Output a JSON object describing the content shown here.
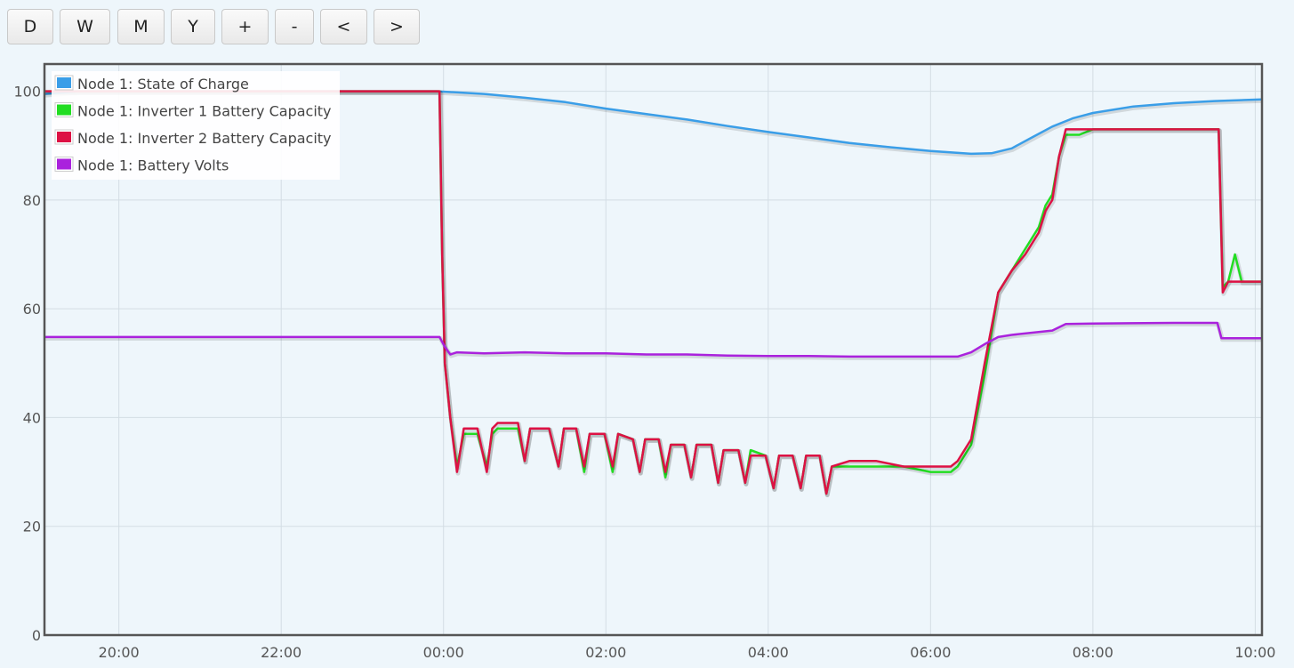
{
  "toolbar": {
    "buttons": [
      {
        "name": "day-button",
        "label": "D"
      },
      {
        "name": "week-button",
        "label": "W"
      },
      {
        "name": "month-button",
        "label": "M"
      },
      {
        "name": "year-button",
        "label": "Y"
      },
      {
        "name": "zoom-in-button",
        "label": "+"
      },
      {
        "name": "zoom-out-button",
        "label": "-"
      },
      {
        "name": "prev-button",
        "label": "<"
      },
      {
        "name": "next-button",
        "label": ">"
      }
    ]
  },
  "chart_data": {
    "type": "line",
    "x_unit": "time",
    "xlim": [
      "19:05",
      "10:05"
    ],
    "ylim": [
      0,
      105
    ],
    "x_ticks": [
      "20:00",
      "22:00",
      "00:00",
      "02:00",
      "04:00",
      "06:00",
      "08:00",
      "10:00"
    ],
    "y_ticks": [
      0,
      20,
      40,
      60,
      80,
      100
    ],
    "grid": true,
    "legend_position": "top-left",
    "colors": {
      "background": "#eef6fb",
      "frame": "#555555",
      "grid": "#d3dde4"
    },
    "series": [
      {
        "name": "Node 1: State of Charge",
        "color": "#3a9ee8",
        "points": [
          [
            "19:05",
            99.5
          ],
          [
            "19:30",
            100
          ],
          [
            "23:55",
            100
          ],
          [
            "00:30",
            99.5
          ],
          [
            "01:00",
            98.8
          ],
          [
            "01:30",
            98
          ],
          [
            "02:00",
            96.8
          ],
          [
            "02:30",
            95.8
          ],
          [
            "03:00",
            94.8
          ],
          [
            "03:30",
            93.6
          ],
          [
            "04:00",
            92.5
          ],
          [
            "04:30",
            91.5
          ],
          [
            "05:00",
            90.5
          ],
          [
            "05:30",
            89.7
          ],
          [
            "06:00",
            89
          ],
          [
            "06:30",
            88.5
          ],
          [
            "06:45",
            88.6
          ],
          [
            "07:00",
            89.5
          ],
          [
            "07:15",
            91.5
          ],
          [
            "07:30",
            93.5
          ],
          [
            "07:45",
            95
          ],
          [
            "08:00",
            96
          ],
          [
            "08:30",
            97.2
          ],
          [
            "09:00",
            97.8
          ],
          [
            "09:30",
            98.2
          ],
          [
            "10:05",
            98.5
          ]
        ]
      },
      {
        "name": "Node 1: Inverter 1 Battery Capacity",
        "color": "#22dd22",
        "points": [
          [
            "19:05",
            100
          ],
          [
            "23:57",
            100
          ],
          [
            "23:59",
            70
          ],
          [
            "00:01",
            50
          ],
          [
            "00:05",
            40
          ],
          [
            "00:10",
            31
          ],
          [
            "00:15",
            37
          ],
          [
            "00:25",
            37
          ],
          [
            "00:32",
            31
          ],
          [
            "00:36",
            37
          ],
          [
            "00:40",
            38
          ],
          [
            "00:55",
            38
          ],
          [
            "01:00",
            32
          ],
          [
            "01:04",
            38
          ],
          [
            "01:18",
            38
          ],
          [
            "01:25",
            31
          ],
          [
            "01:29",
            38
          ],
          [
            "01:38",
            38
          ],
          [
            "01:44",
            30
          ],
          [
            "01:48",
            37
          ],
          [
            "01:59",
            37
          ],
          [
            "02:05",
            30
          ],
          [
            "02:09",
            37
          ],
          [
            "02:20",
            36
          ],
          [
            "02:25",
            30
          ],
          [
            "02:29",
            36
          ],
          [
            "02:39",
            36
          ],
          [
            "02:44",
            29
          ],
          [
            "02:48",
            35
          ],
          [
            "02:58",
            35
          ],
          [
            "03:03",
            29
          ],
          [
            "03:07",
            35
          ],
          [
            "03:18",
            35
          ],
          [
            "03:23",
            28
          ],
          [
            "03:27",
            34
          ],
          [
            "03:38",
            34
          ],
          [
            "03:43",
            28
          ],
          [
            "03:47",
            34
          ],
          [
            "03:58",
            33
          ],
          [
            "04:04",
            27
          ],
          [
            "04:08",
            33
          ],
          [
            "04:18",
            33
          ],
          [
            "04:24",
            27
          ],
          [
            "04:28",
            33
          ],
          [
            "04:38",
            33
          ],
          [
            "04:43",
            26
          ],
          [
            "04:47",
            31
          ],
          [
            "05:00",
            31
          ],
          [
            "05:20",
            31
          ],
          [
            "05:40",
            31
          ],
          [
            "06:00",
            30
          ],
          [
            "06:15",
            30
          ],
          [
            "06:20",
            31
          ],
          [
            "06:30",
            35
          ],
          [
            "06:40",
            48
          ],
          [
            "06:50",
            63
          ],
          [
            "07:00",
            67
          ],
          [
            "07:10",
            71
          ],
          [
            "07:20",
            75
          ],
          [
            "07:25",
            79
          ],
          [
            "07:30",
            81
          ],
          [
            "07:35",
            88
          ],
          [
            "07:40",
            92
          ],
          [
            "07:50",
            92
          ],
          [
            "08:00",
            93
          ],
          [
            "08:30",
            93
          ],
          [
            "09:00",
            93
          ],
          [
            "09:30",
            93
          ],
          [
            "09:33",
            93
          ],
          [
            "09:36",
            64
          ],
          [
            "09:40",
            65
          ],
          [
            "09:45",
            70
          ],
          [
            "09:50",
            65
          ],
          [
            "10:05",
            65
          ]
        ]
      },
      {
        "name": "Node 1: Inverter 2 Battery Capacity",
        "color": "#dd1144",
        "points": [
          [
            "19:05",
            100
          ],
          [
            "23:57",
            100
          ],
          [
            "23:59",
            70
          ],
          [
            "00:01",
            50
          ],
          [
            "00:05",
            40
          ],
          [
            "00:10",
            30
          ],
          [
            "00:15",
            38
          ],
          [
            "00:25",
            38
          ],
          [
            "00:32",
            30
          ],
          [
            "00:36",
            38
          ],
          [
            "00:40",
            39
          ],
          [
            "00:55",
            39
          ],
          [
            "01:00",
            32
          ],
          [
            "01:04",
            38
          ],
          [
            "01:18",
            38
          ],
          [
            "01:25",
            31
          ],
          [
            "01:29",
            38
          ],
          [
            "01:38",
            38
          ],
          [
            "01:44",
            31
          ],
          [
            "01:48",
            37
          ],
          [
            "01:59",
            37
          ],
          [
            "02:05",
            31
          ],
          [
            "02:09",
            37
          ],
          [
            "02:20",
            36
          ],
          [
            "02:25",
            30
          ],
          [
            "02:29",
            36
          ],
          [
            "02:39",
            36
          ],
          [
            "02:44",
            30
          ],
          [
            "02:48",
            35
          ],
          [
            "02:58",
            35
          ],
          [
            "03:03",
            29
          ],
          [
            "03:07",
            35
          ],
          [
            "03:18",
            35
          ],
          [
            "03:23",
            28
          ],
          [
            "03:27",
            34
          ],
          [
            "03:38",
            34
          ],
          [
            "03:43",
            28
          ],
          [
            "03:47",
            33
          ],
          [
            "03:58",
            33
          ],
          [
            "04:04",
            27
          ],
          [
            "04:08",
            33
          ],
          [
            "04:18",
            33
          ],
          [
            "04:24",
            27
          ],
          [
            "04:28",
            33
          ],
          [
            "04:38",
            33
          ],
          [
            "04:43",
            26
          ],
          [
            "04:47",
            31
          ],
          [
            "05:00",
            32
          ],
          [
            "05:20",
            32
          ],
          [
            "05:40",
            31
          ],
          [
            "06:00",
            31
          ],
          [
            "06:15",
            31
          ],
          [
            "06:20",
            32
          ],
          [
            "06:30",
            36
          ],
          [
            "06:40",
            50
          ],
          [
            "06:50",
            63
          ],
          [
            "07:00",
            67
          ],
          [
            "07:10",
            70
          ],
          [
            "07:20",
            74
          ],
          [
            "07:25",
            78
          ],
          [
            "07:30",
            80
          ],
          [
            "07:35",
            88
          ],
          [
            "07:40",
            93
          ],
          [
            "07:50",
            93
          ],
          [
            "08:00",
            93
          ],
          [
            "08:30",
            93
          ],
          [
            "09:00",
            93
          ],
          [
            "09:30",
            93
          ],
          [
            "09:33",
            93
          ],
          [
            "09:36",
            63
          ],
          [
            "09:40",
            65
          ],
          [
            "09:50",
            65
          ],
          [
            "10:05",
            65
          ]
        ]
      },
      {
        "name": "Node 1: Battery Volts",
        "color": "#aa22dd",
        "points": [
          [
            "19:05",
            54.8
          ],
          [
            "23:57",
            54.8
          ],
          [
            "00:01",
            53
          ],
          [
            "00:05",
            51.6
          ],
          [
            "00:10",
            52
          ],
          [
            "00:30",
            51.8
          ],
          [
            "01:00",
            52
          ],
          [
            "01:30",
            51.8
          ],
          [
            "02:00",
            51.8
          ],
          [
            "02:30",
            51.6
          ],
          [
            "03:00",
            51.6
          ],
          [
            "03:30",
            51.4
          ],
          [
            "04:00",
            51.3
          ],
          [
            "04:30",
            51.3
          ],
          [
            "05:00",
            51.2
          ],
          [
            "05:30",
            51.2
          ],
          [
            "06:00",
            51.2
          ],
          [
            "06:20",
            51.2
          ],
          [
            "06:30",
            52
          ],
          [
            "06:40",
            53.5
          ],
          [
            "06:50",
            54.8
          ],
          [
            "07:00",
            55.2
          ],
          [
            "07:30",
            56
          ],
          [
            "07:40",
            57.2
          ],
          [
            "08:00",
            57.3
          ],
          [
            "09:00",
            57.4
          ],
          [
            "09:30",
            57.4
          ],
          [
            "09:32",
            57.4
          ],
          [
            "09:35",
            54.6
          ],
          [
            "10:05",
            54.6
          ]
        ]
      }
    ]
  }
}
